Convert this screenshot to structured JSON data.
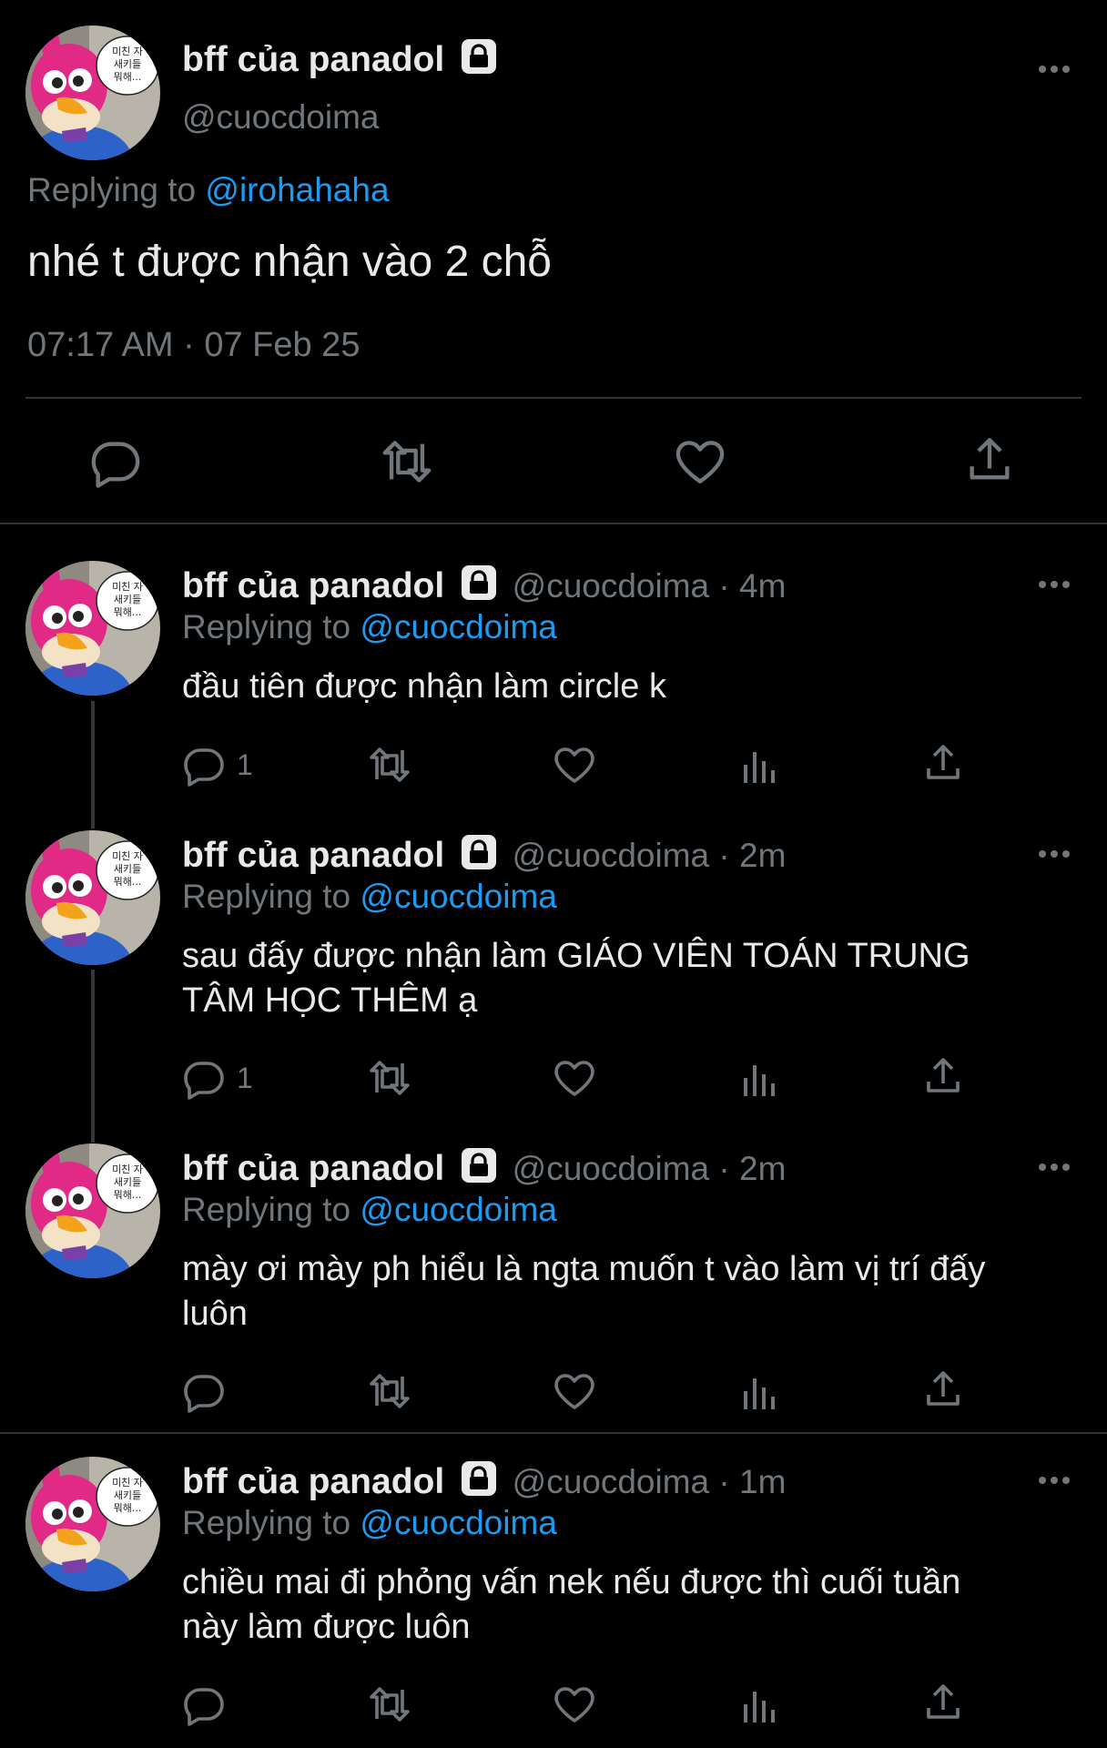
{
  "main": {
    "display_name": "bff của panadol",
    "handle": "@cuocdoima",
    "replying_prefix": "Replying to",
    "replying_to": "@irohahaha",
    "text": "nhé t được nhận vào 2 chỗ",
    "timestamp": "07:17 AM · 07 Feb 25"
  },
  "replies": [
    {
      "display_name": "bff của panadol",
      "meta": "@cuocdoima · 4m",
      "replying_prefix": "Replying to",
      "replying_to": "@cuocdoima",
      "text": "đầu tiên được nhận làm circle k",
      "reply_count": "1"
    },
    {
      "display_name": "bff của panadol",
      "meta": "@cuocdoima · 2m",
      "replying_prefix": "Replying to",
      "replying_to": "@cuocdoima",
      "text_line1": "sau đấy được nhận làm GIÁO VIÊN TOÁN TRUNG",
      "text_line2": "TÂM HỌC THÊM ạ",
      "reply_count": "1"
    },
    {
      "display_name": "bff của panadol",
      "meta": "@cuocdoima · 2m",
      "replying_prefix": "Replying to",
      "replying_to": "@cuocdoima",
      "text_line1": "mày ơi mày ph hiểu là ngta muốn t vào làm vị trí đấy",
      "text_line2": "luôn"
    },
    {
      "display_name": "bff của panadol",
      "meta": "@cuocdoima · 1m",
      "replying_prefix": "Replying to",
      "replying_to": "@cuocdoima",
      "text_line1": "chiều mai đi phỏng vấn nek nếu được thì cuối tuần",
      "text_line2": "này làm được luôn"
    }
  ],
  "avatar": {
    "speech_bubble_text": [
      "미친 자",
      "새키들",
      "뭐해..."
    ]
  },
  "colors": {
    "background": "#000000",
    "text": "#e7e9ea",
    "muted": "#71767b",
    "link": "#1d9bf0"
  },
  "icons": [
    "lock-icon",
    "more-icon",
    "reply-icon",
    "retweet-icon",
    "like-icon",
    "views-icon",
    "share-icon"
  ]
}
